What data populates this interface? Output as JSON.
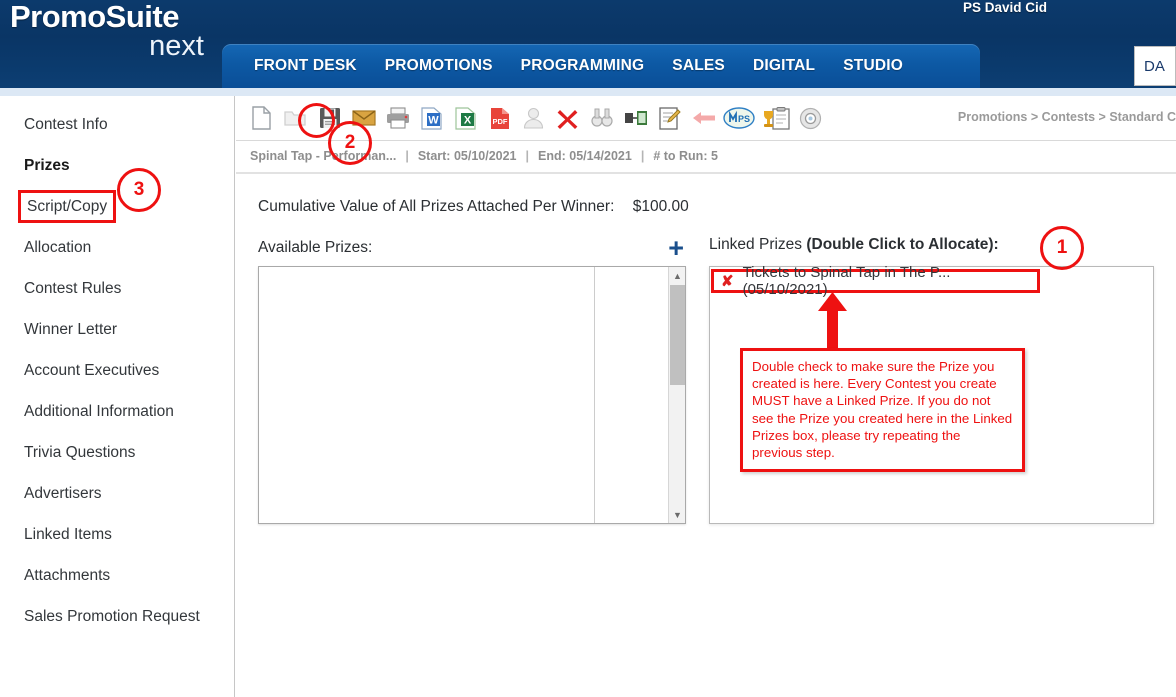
{
  "header": {
    "logo_line1": "PromoSuite",
    "logo_line2": "next",
    "user": "PS David Cid",
    "search_value": "DA",
    "nav": [
      {
        "label": "FRONT DESK"
      },
      {
        "label": "PROMOTIONS"
      },
      {
        "label": "PROGRAMMING"
      },
      {
        "label": "SALES"
      },
      {
        "label": "DIGITAL"
      },
      {
        "label": "STUDIO"
      }
    ]
  },
  "sidebar": {
    "items": [
      {
        "label": "Contest Info",
        "state": "normal"
      },
      {
        "label": "Prizes",
        "state": "active"
      },
      {
        "label": "Script/Copy",
        "state": "boxed"
      },
      {
        "label": "Allocation",
        "state": "normal"
      },
      {
        "label": "Contest Rules",
        "state": "normal"
      },
      {
        "label": "Winner Letter",
        "state": "normal"
      },
      {
        "label": "Account Executives",
        "state": "normal"
      },
      {
        "label": "Additional Information",
        "state": "normal"
      },
      {
        "label": "Trivia Questions",
        "state": "normal"
      },
      {
        "label": "Advertisers",
        "state": "normal"
      },
      {
        "label": "Linked Items",
        "state": "normal"
      },
      {
        "label": "Attachments",
        "state": "normal"
      },
      {
        "label": "Sales Promotion Request",
        "state": "normal"
      }
    ]
  },
  "toolbar": {
    "icons": [
      "new-document-icon",
      "folder-open-icon",
      "save-icon",
      "email-icon",
      "print-icon",
      "export-word-icon",
      "export-excel-icon",
      "export-pdf-icon",
      "user-icon",
      "delete-icon",
      "binoculars-icon",
      "contacts-icon",
      "edit-note-icon",
      "back-arrow-icon",
      "mps-logo-icon",
      "trophy-clipboard-icon",
      "settings-gear-icon"
    ],
    "breadcrumb": "Promotions > Contests > Standard C"
  },
  "context_bar": {
    "title": "Spinal Tap - Performan...",
    "start_label": "Start: 05/10/2021",
    "end_label": "End: 05/14/2021",
    "to_run_label": "# to Run: 5",
    "separator": "|"
  },
  "main": {
    "cumulative_label": "Cumulative Value of All Prizes Attached Per Winner:",
    "cumulative_value": "$100.00",
    "available_prizes_label": "Available Prizes:",
    "add_prize_icon": "+",
    "available_prizes": [],
    "linked_prizes_label": "Linked Prizes",
    "linked_prizes_hint": "(Double Click to Allocate):",
    "linked_prizes": [
      {
        "remove_icon": "✘",
        "label": "Tickets to Spinal Tap in The P...(05/10/2021)"
      }
    ]
  },
  "annotations": {
    "callout_1": "1",
    "callout_2": "2",
    "callout_3": "3",
    "note": "Double check to make sure the Prize you created is here. Every Contest you create MUST have a Linked Prize. If you do not see the Prize you created here in the Linked Prizes box, please try repeating the previous step.",
    "accent_color": "#ee1111"
  }
}
